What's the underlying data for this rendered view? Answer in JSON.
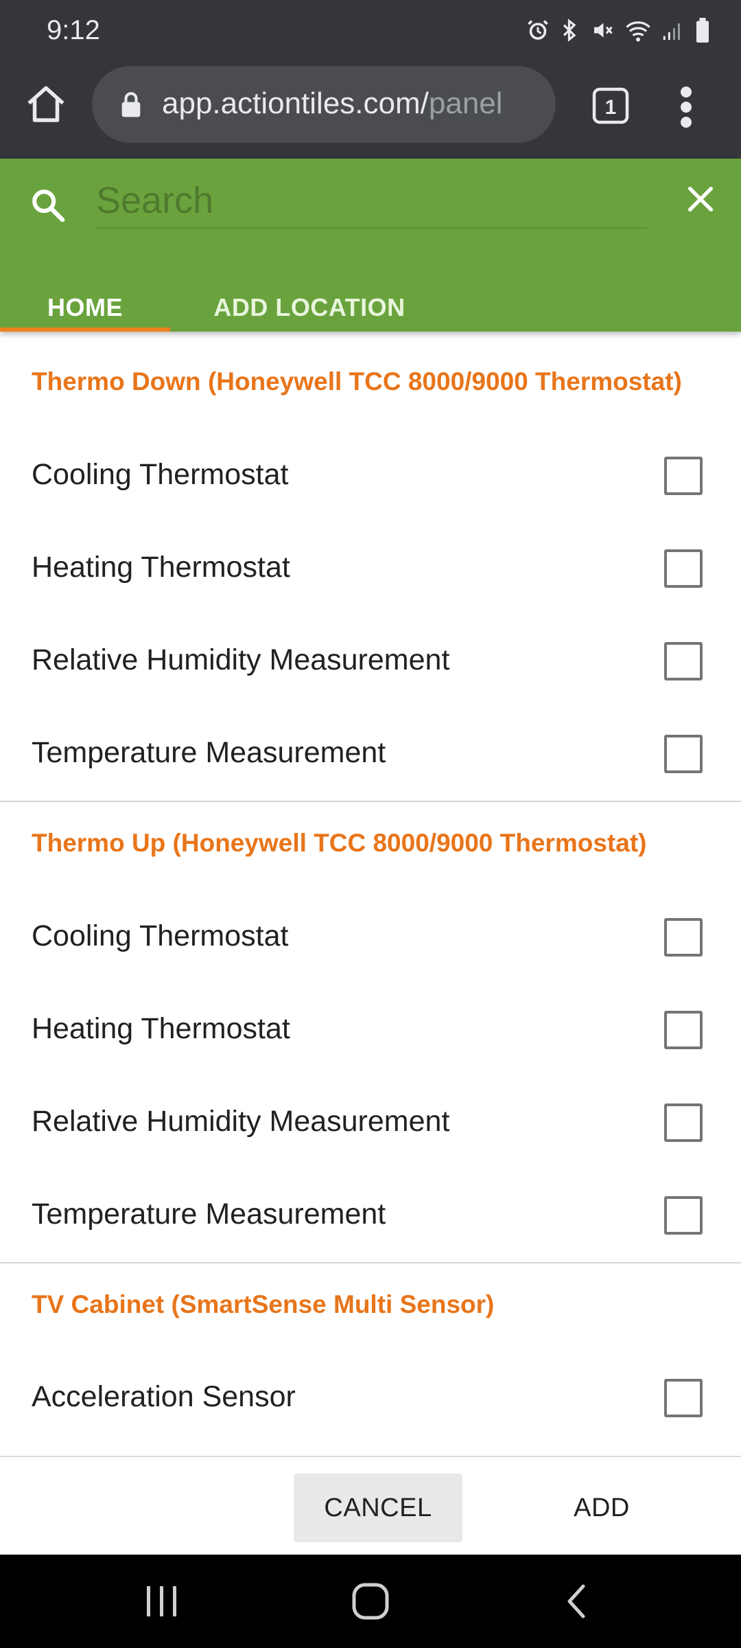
{
  "status_bar": {
    "time": "9:12",
    "icons": [
      "alarm-icon",
      "bluetooth-icon",
      "vibrate-mute-icon",
      "wifi-icon",
      "signal-icon",
      "battery-icon"
    ]
  },
  "browser": {
    "url_main": "app.actiontiles.com/",
    "url_dim": "panel",
    "tab_count": "1"
  },
  "app": {
    "search": {
      "placeholder": "Search",
      "value": ""
    },
    "tabs": [
      {
        "label": "HOME",
        "active": true
      },
      {
        "label": "ADD LOCATION",
        "active": false
      }
    ],
    "accent": "#6aa33d",
    "highlight": "#e8751a"
  },
  "groups": [
    {
      "title": "Thermo Down (Honeywell TCC 8000/9000 Thermostat)",
      "items": [
        {
          "label": "Cooling Thermostat",
          "checked": false
        },
        {
          "label": "Heating Thermostat",
          "checked": false
        },
        {
          "label": "Relative Humidity Measurement",
          "checked": false
        },
        {
          "label": "Temperature Measurement",
          "checked": false
        }
      ]
    },
    {
      "title": "Thermo Up (Honeywell TCC 8000/9000 Thermostat)",
      "items": [
        {
          "label": "Cooling Thermostat",
          "checked": false
        },
        {
          "label": "Heating Thermostat",
          "checked": false
        },
        {
          "label": "Relative Humidity Measurement",
          "checked": false
        },
        {
          "label": "Temperature Measurement",
          "checked": false
        }
      ]
    },
    {
      "title": "TV Cabinet (SmartSense Multi Sensor)",
      "items": [
        {
          "label": "Acceleration Sensor",
          "checked": false
        }
      ]
    }
  ],
  "footer": {
    "cancel_label": "CANCEL",
    "add_label": "ADD"
  }
}
